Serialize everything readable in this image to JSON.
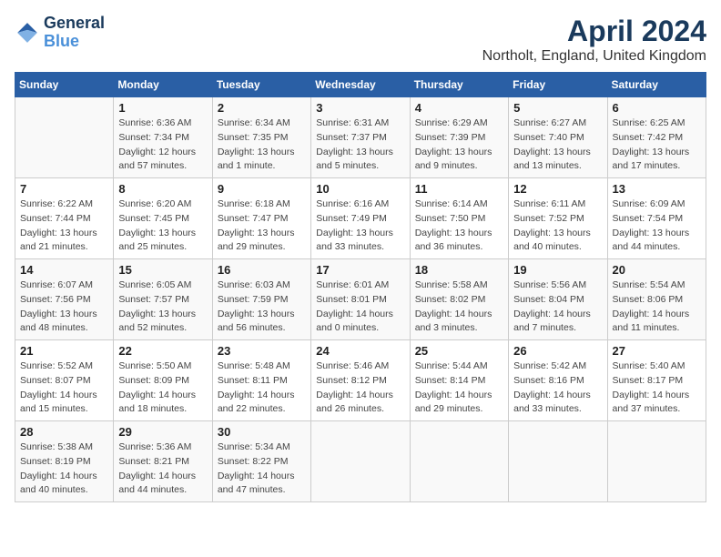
{
  "logo": {
    "line1": "General",
    "line2": "Blue"
  },
  "title": "April 2024",
  "subtitle": "Northolt, England, United Kingdom",
  "days_of_week": [
    "Sunday",
    "Monday",
    "Tuesday",
    "Wednesday",
    "Thursday",
    "Friday",
    "Saturday"
  ],
  "weeks": [
    [
      {
        "day": "",
        "info": ""
      },
      {
        "day": "1",
        "info": "Sunrise: 6:36 AM\nSunset: 7:34 PM\nDaylight: 12 hours\nand 57 minutes."
      },
      {
        "day": "2",
        "info": "Sunrise: 6:34 AM\nSunset: 7:35 PM\nDaylight: 13 hours\nand 1 minute."
      },
      {
        "day": "3",
        "info": "Sunrise: 6:31 AM\nSunset: 7:37 PM\nDaylight: 13 hours\nand 5 minutes."
      },
      {
        "day": "4",
        "info": "Sunrise: 6:29 AM\nSunset: 7:39 PM\nDaylight: 13 hours\nand 9 minutes."
      },
      {
        "day": "5",
        "info": "Sunrise: 6:27 AM\nSunset: 7:40 PM\nDaylight: 13 hours\nand 13 minutes."
      },
      {
        "day": "6",
        "info": "Sunrise: 6:25 AM\nSunset: 7:42 PM\nDaylight: 13 hours\nand 17 minutes."
      }
    ],
    [
      {
        "day": "7",
        "info": "Sunrise: 6:22 AM\nSunset: 7:44 PM\nDaylight: 13 hours\nand 21 minutes."
      },
      {
        "day": "8",
        "info": "Sunrise: 6:20 AM\nSunset: 7:45 PM\nDaylight: 13 hours\nand 25 minutes."
      },
      {
        "day": "9",
        "info": "Sunrise: 6:18 AM\nSunset: 7:47 PM\nDaylight: 13 hours\nand 29 minutes."
      },
      {
        "day": "10",
        "info": "Sunrise: 6:16 AM\nSunset: 7:49 PM\nDaylight: 13 hours\nand 33 minutes."
      },
      {
        "day": "11",
        "info": "Sunrise: 6:14 AM\nSunset: 7:50 PM\nDaylight: 13 hours\nand 36 minutes."
      },
      {
        "day": "12",
        "info": "Sunrise: 6:11 AM\nSunset: 7:52 PM\nDaylight: 13 hours\nand 40 minutes."
      },
      {
        "day": "13",
        "info": "Sunrise: 6:09 AM\nSunset: 7:54 PM\nDaylight: 13 hours\nand 44 minutes."
      }
    ],
    [
      {
        "day": "14",
        "info": "Sunrise: 6:07 AM\nSunset: 7:56 PM\nDaylight: 13 hours\nand 48 minutes."
      },
      {
        "day": "15",
        "info": "Sunrise: 6:05 AM\nSunset: 7:57 PM\nDaylight: 13 hours\nand 52 minutes."
      },
      {
        "day": "16",
        "info": "Sunrise: 6:03 AM\nSunset: 7:59 PM\nDaylight: 13 hours\nand 56 minutes."
      },
      {
        "day": "17",
        "info": "Sunrise: 6:01 AM\nSunset: 8:01 PM\nDaylight: 14 hours\nand 0 minutes."
      },
      {
        "day": "18",
        "info": "Sunrise: 5:58 AM\nSunset: 8:02 PM\nDaylight: 14 hours\nand 3 minutes."
      },
      {
        "day": "19",
        "info": "Sunrise: 5:56 AM\nSunset: 8:04 PM\nDaylight: 14 hours\nand 7 minutes."
      },
      {
        "day": "20",
        "info": "Sunrise: 5:54 AM\nSunset: 8:06 PM\nDaylight: 14 hours\nand 11 minutes."
      }
    ],
    [
      {
        "day": "21",
        "info": "Sunrise: 5:52 AM\nSunset: 8:07 PM\nDaylight: 14 hours\nand 15 minutes."
      },
      {
        "day": "22",
        "info": "Sunrise: 5:50 AM\nSunset: 8:09 PM\nDaylight: 14 hours\nand 18 minutes."
      },
      {
        "day": "23",
        "info": "Sunrise: 5:48 AM\nSunset: 8:11 PM\nDaylight: 14 hours\nand 22 minutes."
      },
      {
        "day": "24",
        "info": "Sunrise: 5:46 AM\nSunset: 8:12 PM\nDaylight: 14 hours\nand 26 minutes."
      },
      {
        "day": "25",
        "info": "Sunrise: 5:44 AM\nSunset: 8:14 PM\nDaylight: 14 hours\nand 29 minutes."
      },
      {
        "day": "26",
        "info": "Sunrise: 5:42 AM\nSunset: 8:16 PM\nDaylight: 14 hours\nand 33 minutes."
      },
      {
        "day": "27",
        "info": "Sunrise: 5:40 AM\nSunset: 8:17 PM\nDaylight: 14 hours\nand 37 minutes."
      }
    ],
    [
      {
        "day": "28",
        "info": "Sunrise: 5:38 AM\nSunset: 8:19 PM\nDaylight: 14 hours\nand 40 minutes."
      },
      {
        "day": "29",
        "info": "Sunrise: 5:36 AM\nSunset: 8:21 PM\nDaylight: 14 hours\nand 44 minutes."
      },
      {
        "day": "30",
        "info": "Sunrise: 5:34 AM\nSunset: 8:22 PM\nDaylight: 14 hours\nand 47 minutes."
      },
      {
        "day": "",
        "info": ""
      },
      {
        "day": "",
        "info": ""
      },
      {
        "day": "",
        "info": ""
      },
      {
        "day": "",
        "info": ""
      }
    ]
  ]
}
